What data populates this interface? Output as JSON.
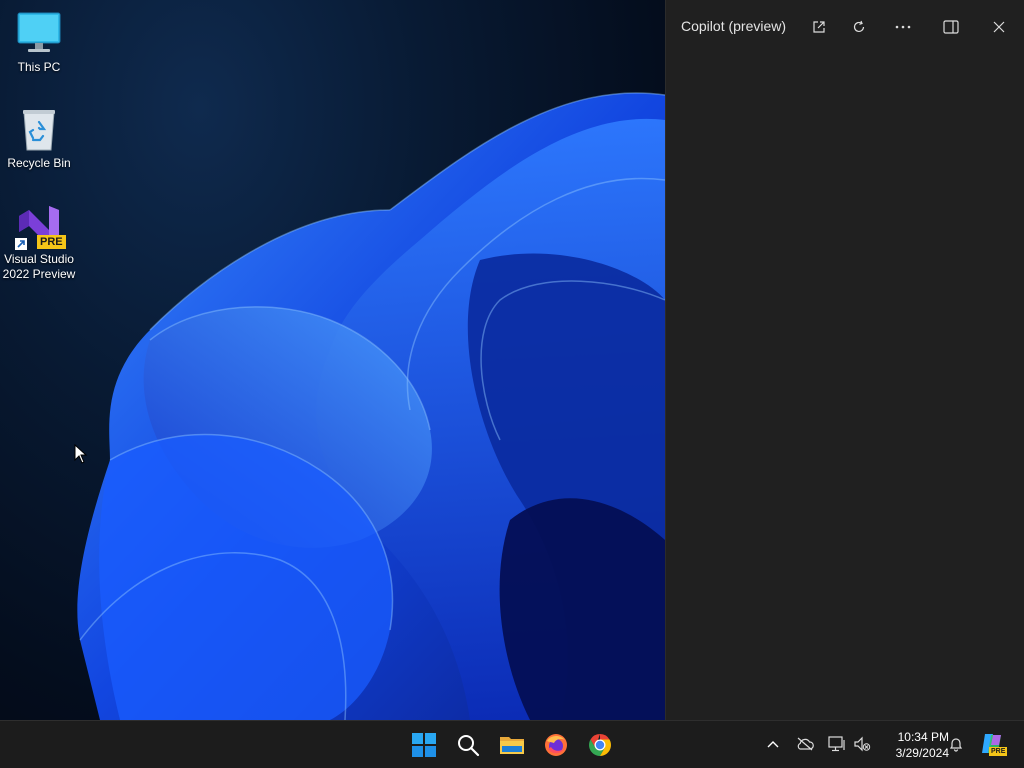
{
  "desktop": {
    "icons": [
      {
        "label": "This PC",
        "icon": "this-pc-icon"
      },
      {
        "label": "Recycle Bin",
        "icon": "recycle-bin-icon"
      },
      {
        "label_line1": "Visual Studio",
        "label_line2": "2022 Preview",
        "badge": "PRE",
        "icon": "visual-studio-icon"
      }
    ]
  },
  "copilot": {
    "title": "Copilot (preview)",
    "buttons": [
      "open-external-icon",
      "refresh-icon",
      "more-icon",
      "dock-panel-icon",
      "close-icon"
    ]
  },
  "taskbar": {
    "apps": [
      "windows-start-icon",
      "search-icon",
      "file-explorer-icon",
      "firefox-icon",
      "chrome-icon"
    ],
    "tray": [
      "chevron-up-icon",
      "onedrive-offline-icon",
      "network-icon",
      "volume-muted-icon",
      "bell-icon",
      "copilot-icon"
    ],
    "time": "10:34 PM",
    "date": "3/29/2024",
    "copilot_badge": "PRE"
  },
  "colors": {
    "accent": "#1f6bff",
    "pane_bg": "#202020",
    "taskbar_bg": "#1c1c1c",
    "vs_badge": "#f5c518"
  }
}
